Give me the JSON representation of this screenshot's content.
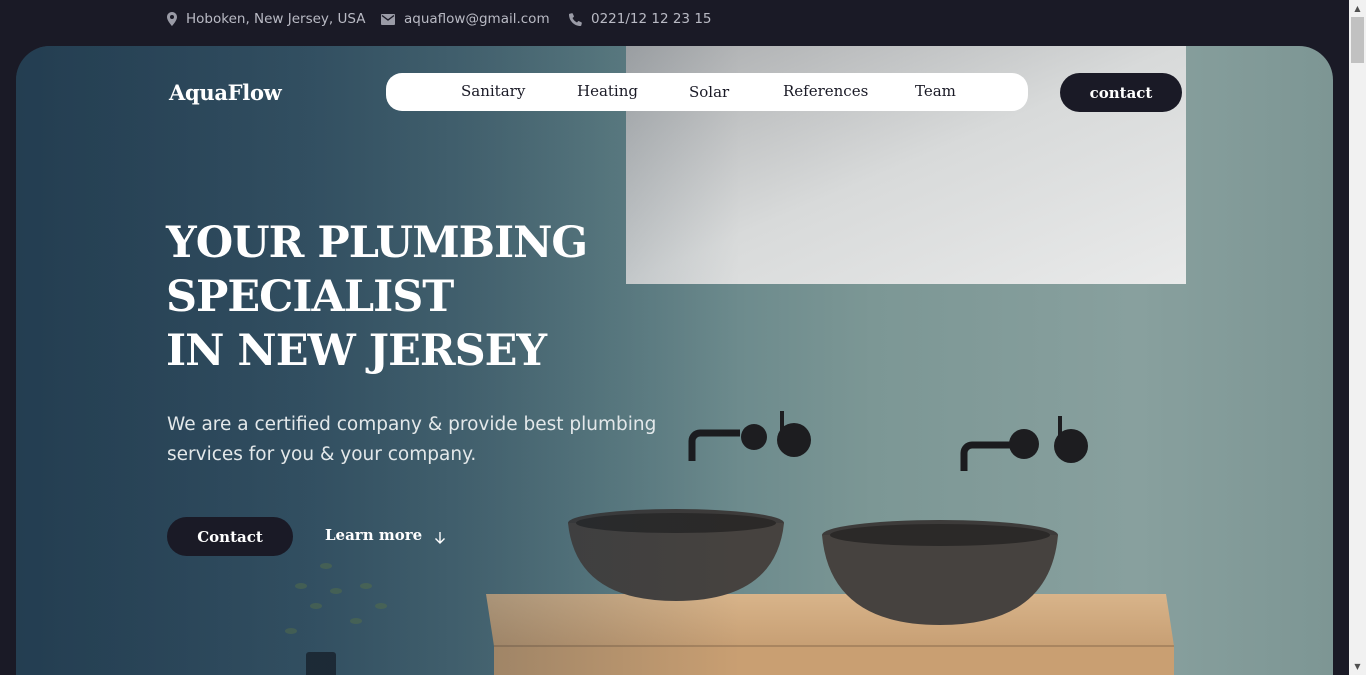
{
  "topbar": {
    "address": "Hoboken, New Jersey, USA",
    "email": "aquaflow@gmail.com",
    "phone": "0221/12 12 23 15"
  },
  "header": {
    "logo": "AquaFlow",
    "nav": [
      "Sanitary",
      "Heating",
      "Solar",
      "References",
      "Team"
    ],
    "contact_label": "contact"
  },
  "hero": {
    "headline": [
      "YOUR PLUMBING",
      "SPECIALIST",
      "IN NEW JERSEY"
    ],
    "subtext": "We are a certified company & provide best plumbing services for you & your company.",
    "primary_button": "Contact",
    "secondary_button": "Learn more"
  },
  "icons": {
    "address": "location-pin-icon",
    "email": "envelope-icon",
    "phone": "phone-icon",
    "learn_more": "arrow-down-icon"
  },
  "colors": {
    "dark": "#1a1a26",
    "white": "#ffffff",
    "info_text": "#b9bac4"
  }
}
